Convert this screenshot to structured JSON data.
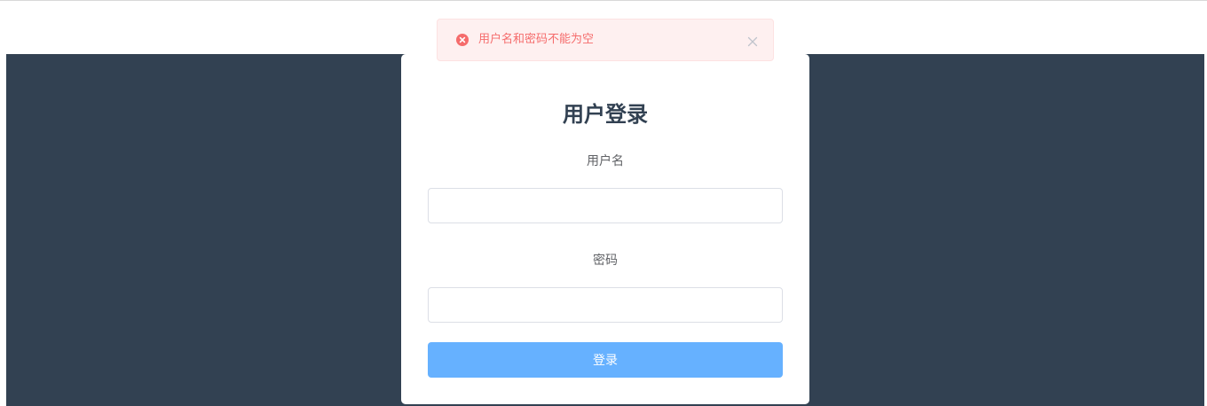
{
  "alert": {
    "message": "用户名和密码不能为空",
    "type": "error",
    "icon": "error-circle-icon",
    "close_icon": "close-icon"
  },
  "login_form": {
    "title": "用户登录",
    "username_label": "用户名",
    "username_value": "",
    "password_label": "密码",
    "password_value": "",
    "submit_label": "登录"
  },
  "colors": {
    "backdrop": "#324152",
    "primary_button": "#66b1ff",
    "error": "#f56c6c",
    "error_bg": "#fef0f0"
  }
}
